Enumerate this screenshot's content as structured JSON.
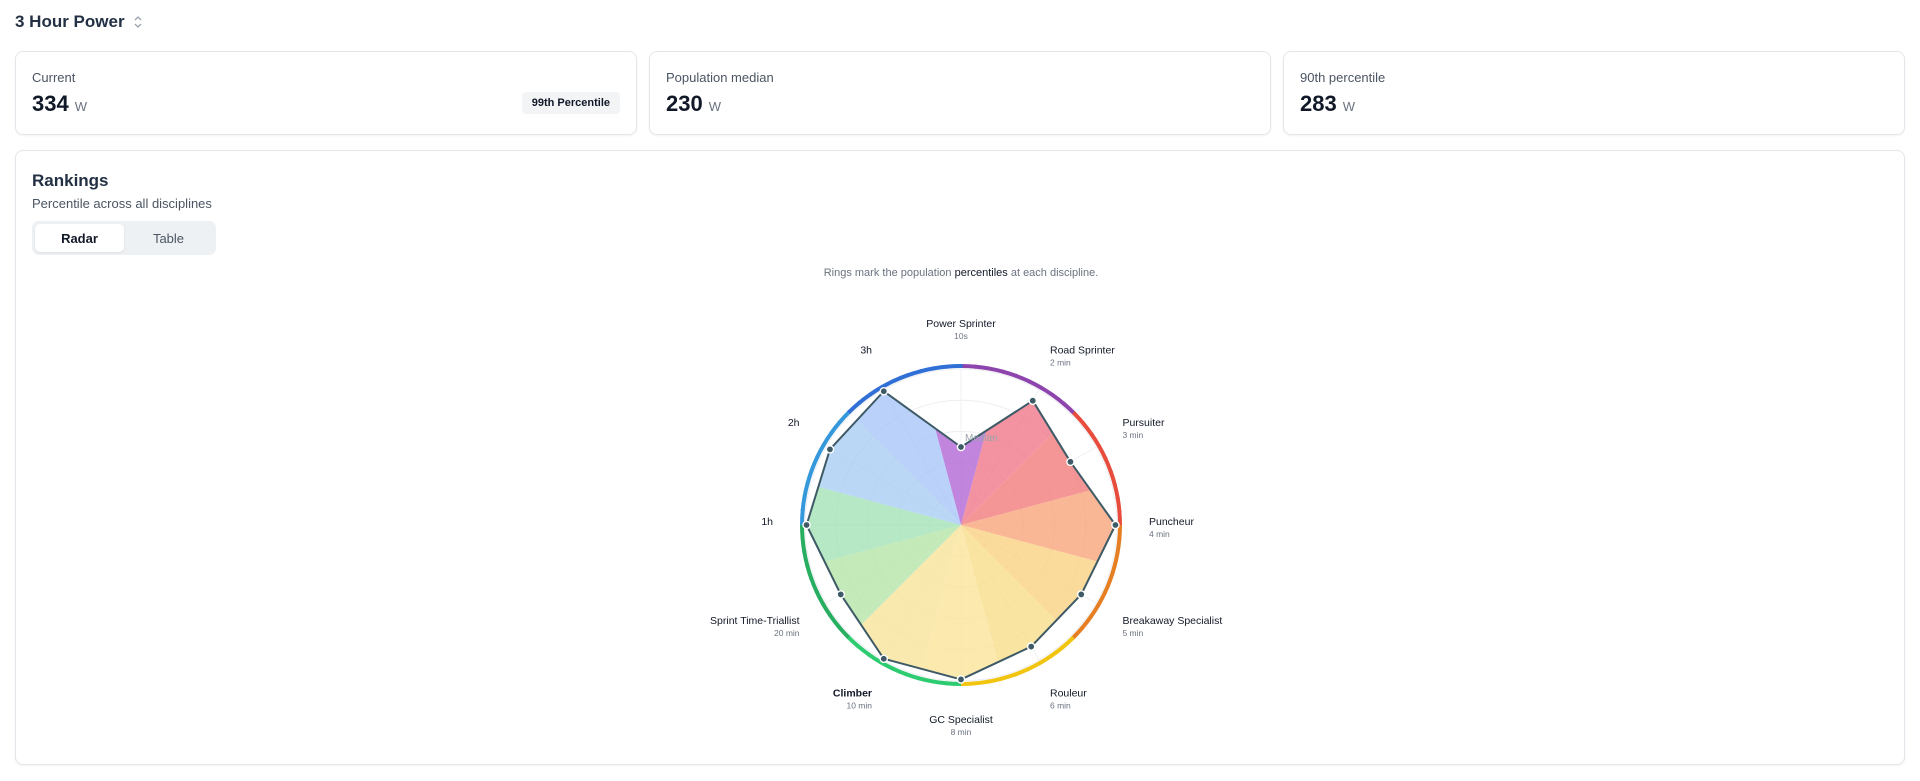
{
  "header": {
    "title": "3 Hour Power",
    "selector_icon": "sort-icon"
  },
  "cards": [
    {
      "label": "Current",
      "value": "334",
      "unit": "W",
      "badge": "99th Percentile"
    },
    {
      "label": "Population median",
      "value": "230",
      "unit": "W"
    },
    {
      "label": "90th percentile",
      "value": "283",
      "unit": "W"
    }
  ],
  "rankings": {
    "title": "Rankings",
    "subtitle": "Percentile across all disciplines",
    "tabs": [
      {
        "label": "Radar",
        "active": true
      },
      {
        "label": "Table",
        "active": false
      }
    ],
    "caption_pre": "Rings mark the population ",
    "caption_bold": "percentiles",
    "caption_post": " at each discipline.",
    "median_label": "Median"
  },
  "chart_data": {
    "type": "radar",
    "axes": [
      {
        "name": "Power Sprinter",
        "sub": "10s",
        "percentile": 50,
        "color": "#b267d6"
      },
      {
        "name": "Road Sprinter",
        "sub": "2 min",
        "percentile": 92,
        "color": "#f0788a"
      },
      {
        "name": "Pursuiter",
        "sub": "3 min",
        "percentile": 81,
        "color": "#f37c7c"
      },
      {
        "name": "Puncheur",
        "sub": "4 min",
        "percentile": 99,
        "color": "#f7a57b"
      },
      {
        "name": "Breakaway Specialist",
        "sub": "5 min",
        "percentile": 89,
        "color": "#f9d283"
      },
      {
        "name": "Rouleur",
        "sub": "6 min",
        "percentile": 90,
        "color": "#f9dd8a"
      },
      {
        "name": "GC Specialist",
        "sub": "8 min",
        "percentile": 99,
        "color": "#fbe49a"
      },
      {
        "name": "Climber",
        "sub": "10 min",
        "percentile": 99,
        "color": "#f9e39b",
        "bold": true
      },
      {
        "name": "Sprint Time-Triallist",
        "sub": "20 min",
        "percentile": 89,
        "color": "#b7e5a8"
      },
      {
        "name": "1h",
        "sub": "",
        "percentile": 99,
        "color": "#a4e2b6"
      },
      {
        "name": "2h",
        "sub": "",
        "percentile": 97,
        "color": "#a9cdf2"
      },
      {
        "name": "3h",
        "sub": "",
        "percentile": 99,
        "color": "#a9c6f8"
      }
    ],
    "rings": [
      20,
      40,
      60,
      80,
      100
    ],
    "outer_ring_colors": [
      "#8e44ad",
      "#e74c3c",
      "#e67e22",
      "#f1c40f",
      "#2ecc71",
      "#27ae60",
      "#3498db",
      "#2f6fd6"
    ]
  }
}
